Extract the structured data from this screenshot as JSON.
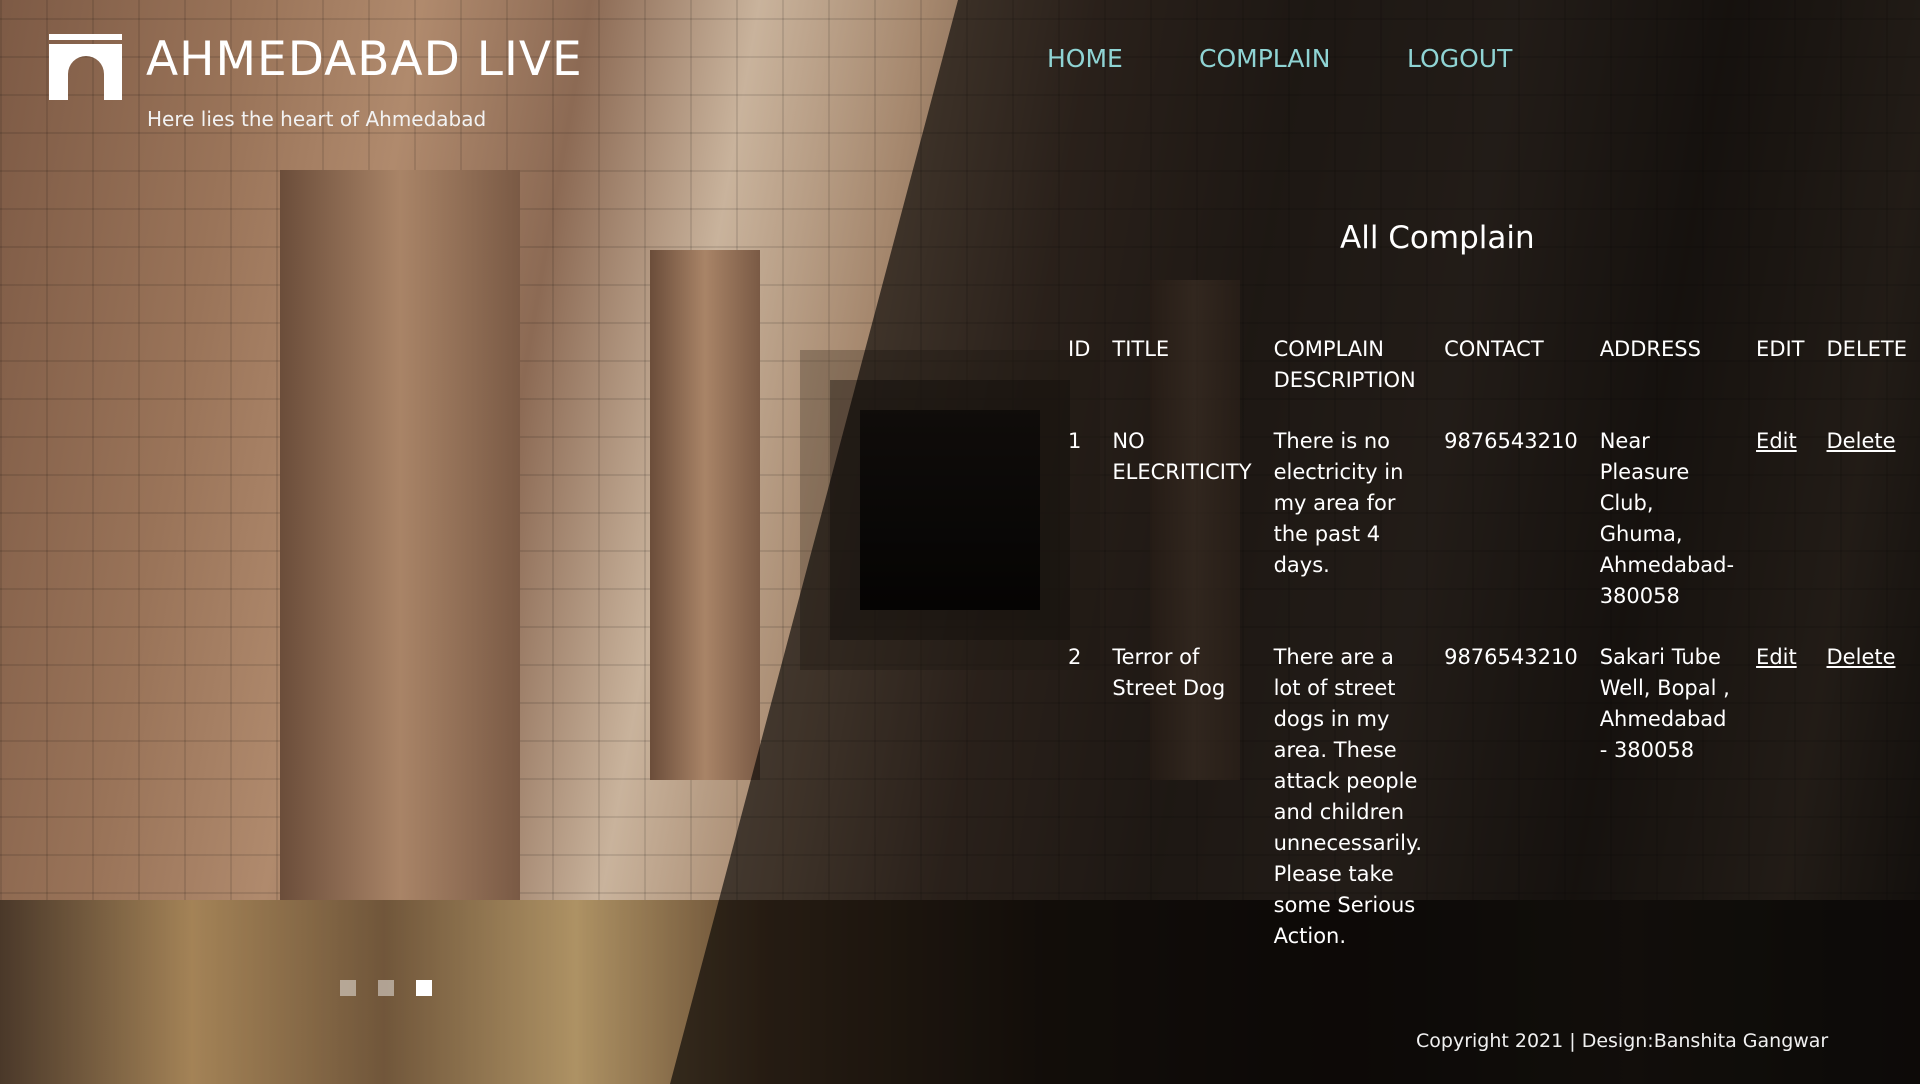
{
  "header": {
    "title": "AHMEDABAD LIVE",
    "tagline": "Here lies the heart of Ahmedabad",
    "logo_icon": "stepwell-arch-icon"
  },
  "nav": {
    "items": [
      {
        "label": "HOME"
      },
      {
        "label": "COMPLAIN"
      },
      {
        "label": "LOGOUT"
      }
    ],
    "link_color": "#8fd4d4"
  },
  "main": {
    "title": "All Complain",
    "table": {
      "columns": [
        "ID",
        "TITLE",
        "COMPLAIN DESCRIPTION",
        "CONTACT",
        "ADDRESS",
        "EDIT",
        "DELETE"
      ],
      "rows": [
        {
          "id": "1",
          "title": "NO ELECRITICITY",
          "description": "There is no electricity in my area for the past 4 days.",
          "contact": "9876543210",
          "address": "Near Pleasure Club, Ghuma, Ahmedabad-380058",
          "edit": "Edit",
          "delete": "Delete"
        },
        {
          "id": "2",
          "title": "Terror of Street Dog",
          "description": "There are a lot of street dogs in my area. These attack people and children unnecessarily. Please take some Serious Action.",
          "contact": "9876543210",
          "address": "Sakari Tube Well, Bopal , Ahmedabad - 380058",
          "edit": "Edit",
          "delete": "Delete"
        }
      ]
    }
  },
  "slider": {
    "count": 3,
    "active_index": 2
  },
  "footer": {
    "copyright": "Copyright 2021 | Design:Banshita Gangwar"
  }
}
